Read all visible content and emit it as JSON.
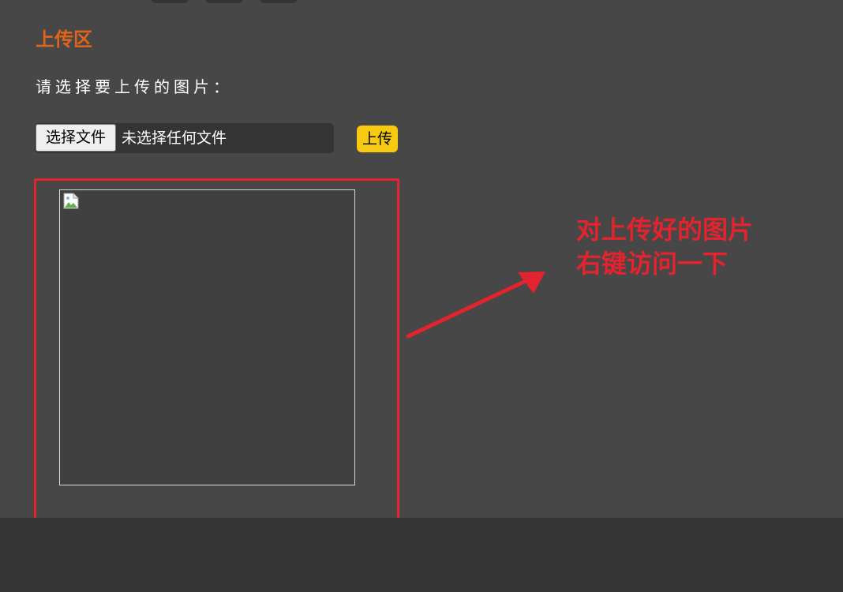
{
  "upload_section": {
    "title": "上传区",
    "prompt": "请选择要上传的图片：",
    "file_input": {
      "button_label": "选择文件",
      "status": "未选择任何文件"
    },
    "upload_button_label": "上传",
    "preview_icon": "broken-image-icon"
  },
  "annotation": {
    "line1": "对上传好的图片",
    "line2": "右键访问一下",
    "color": "#e3232d"
  },
  "colors": {
    "background": "#474747",
    "footer": "#343434",
    "title": "#e1641c",
    "upload_button": "#f7c911"
  }
}
